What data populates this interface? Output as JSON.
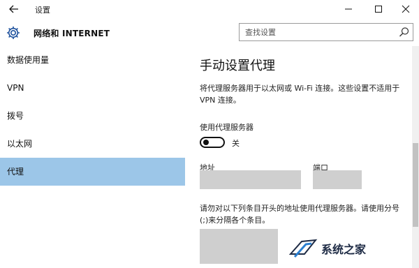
{
  "window": {
    "title": "设置"
  },
  "header": {
    "section_title": "网络和 INTERNET",
    "search_placeholder": "查找设置"
  },
  "sidebar": {
    "items": [
      {
        "label": "数据使用量",
        "active": false
      },
      {
        "label": "VPN",
        "active": false
      },
      {
        "label": "拨号",
        "active": false
      },
      {
        "label": "以太网",
        "active": false
      },
      {
        "label": "代理",
        "active": true
      }
    ]
  },
  "proxy": {
    "title": "手动设置代理",
    "description": "将代理服务器用于以太网或 Wi-Fi 连接。这些设置不适用于 VPN 连接。",
    "use_proxy_label": "使用代理服务器",
    "toggle_state": "关",
    "address_label": "地址",
    "port_label": "端口",
    "address_value": "",
    "port_value": "",
    "exceptions_description": "请勿对以下列条目开头的地址使用代理服务器。请使用分号(;)来分隔各个条目。",
    "exceptions_value": ""
  },
  "watermark": {
    "text": "系统之家"
  },
  "colors": {
    "active_nav": "#9cc6e8",
    "input_fill": "#cfcfcf"
  }
}
